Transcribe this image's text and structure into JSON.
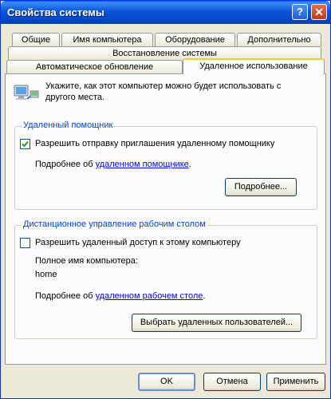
{
  "window": {
    "title": "Свойства системы",
    "help_label": "?",
    "close_label": "✕"
  },
  "tabs": {
    "row1": [
      "Общие",
      "Имя компьютера",
      "Оборудование",
      "Дополнительно"
    ],
    "row2": [
      "Восстановление системы"
    ],
    "row3": [
      "Автоматическое обновление",
      "Удаленное использование"
    ],
    "active": "Удаленное использование"
  },
  "intro": {
    "icon": "remote-computer-icon",
    "text_line1": "Укажите, как этот компьютер можно будет использовать с",
    "text_line2": "другого места."
  },
  "remote_assistance": {
    "legend": "Удаленный помощник",
    "checkbox_label": "Разрешить отправку приглашения удаленному помощнику",
    "checked": true,
    "more_prefix": "Подробнее об ",
    "more_link": "удаленном помощнике",
    "more_suffix": ".",
    "advanced_button": "Подробнее..."
  },
  "remote_desktop": {
    "legend": "Дистанционное управление рабочим столом",
    "checkbox_label": "Разрешить удаленный доступ к этому компьютеру",
    "checked": false,
    "computer_name_label": "Полное имя компьютера:",
    "computer_name": "home",
    "more_prefix": "Подробнее об ",
    "more_link": "удаленном рабочем столе",
    "more_suffix": ".",
    "select_users_button": "Выбрать удаленных пользователей..."
  },
  "footer": {
    "ok": "OK",
    "cancel": "Отмена",
    "apply": "Применить"
  },
  "colors": {
    "title_bar": "#0a55d8",
    "face": "#ece9d8",
    "group_legend": "#0046d5",
    "link": "#0000ff"
  }
}
